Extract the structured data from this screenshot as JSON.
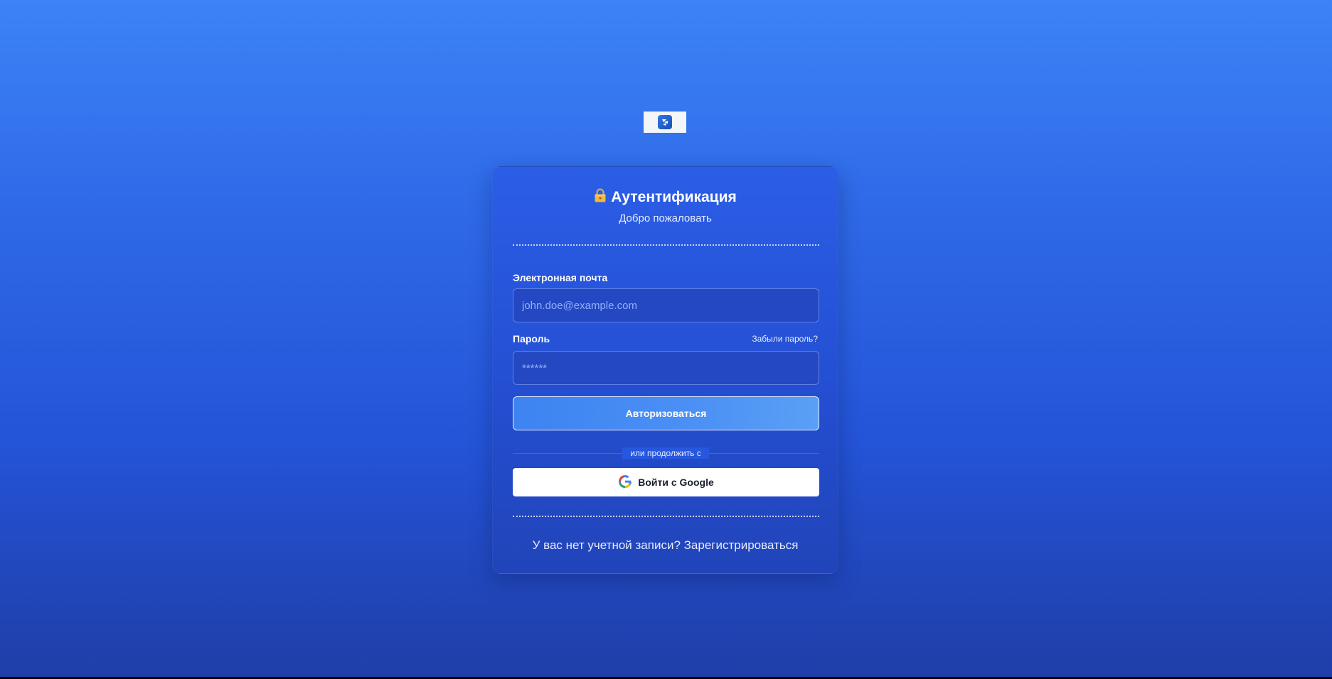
{
  "logo": {
    "icon": "app-logo-icon"
  },
  "card": {
    "title": "Аутентификация",
    "title_icon": "lock-icon",
    "subtitle": "Добро пожаловать"
  },
  "form": {
    "email_label": "Электронная почта",
    "email_placeholder": "john.doe@example.com",
    "email_value": "",
    "password_label": "Пароль",
    "forgot_link": "Забыли пароль?",
    "password_placeholder": "******",
    "password_value": "",
    "submit_label": "Авторизоваться"
  },
  "divider": {
    "text": "или продолжить с"
  },
  "google": {
    "label": "Войти с Google",
    "icon": "google-icon"
  },
  "signup": {
    "prompt": "У вас нет учетной записи?",
    "link": "Зарегистрироваться"
  },
  "colors": {
    "background_top": "#3d83f6",
    "background_bottom": "#1f3ea8",
    "card": "#2450d4",
    "primary_button": "#4a8ff4",
    "lock": "#f4b63c"
  }
}
